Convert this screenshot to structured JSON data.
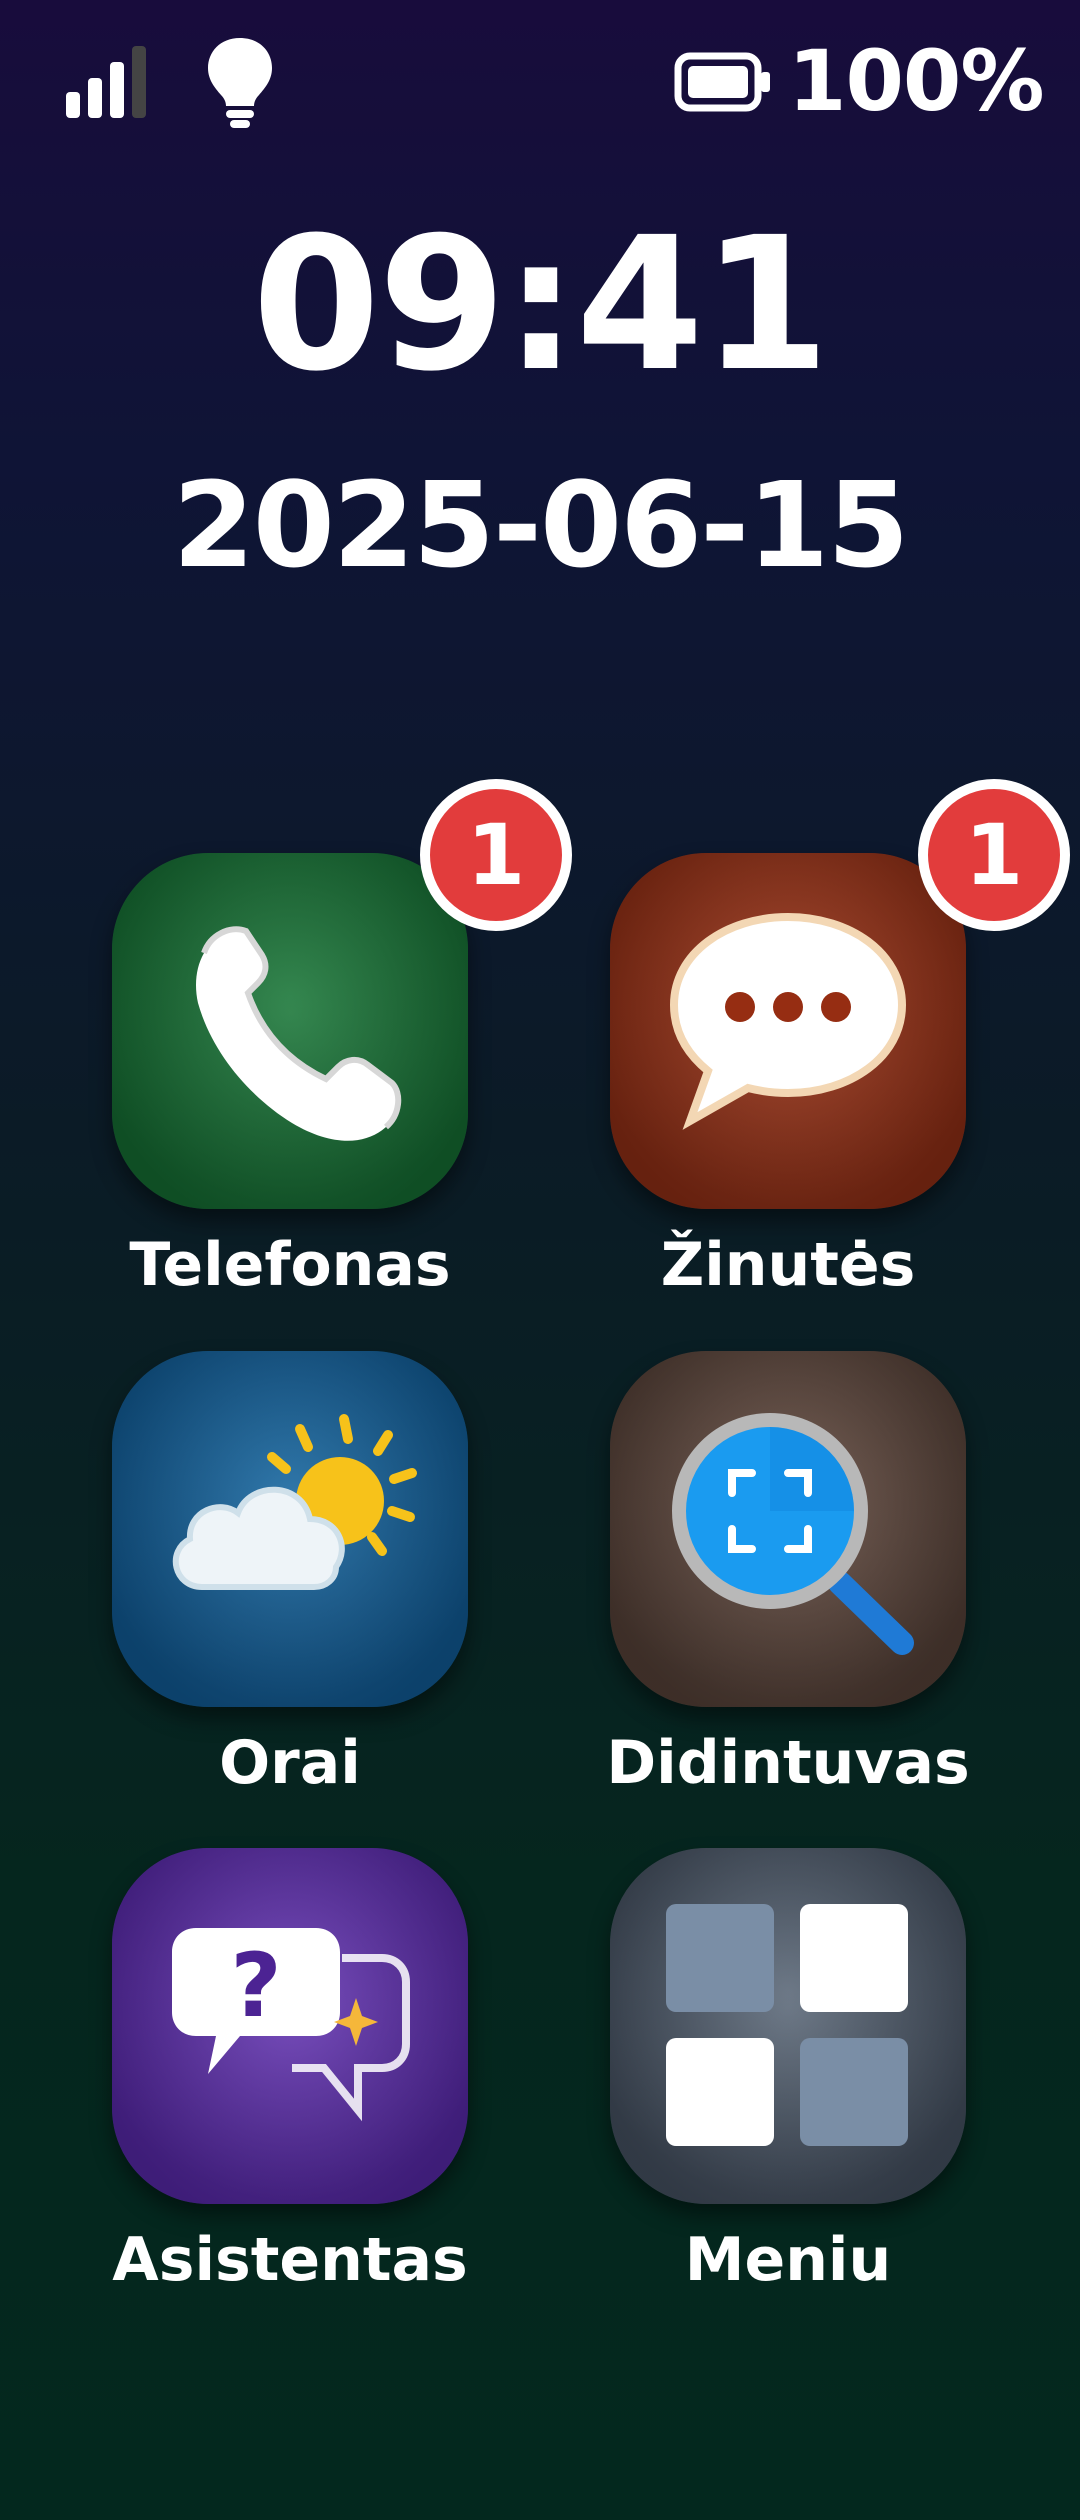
{
  "status_bar": {
    "battery_percent_label": "100%",
    "battery_level": 1.0,
    "signal_bars": 3,
    "signal_max": 4,
    "icons": [
      "signal-icon",
      "lightbulb-icon",
      "battery-icon"
    ]
  },
  "clock": {
    "time": "09:41",
    "date": "2025-06-15"
  },
  "apps": [
    {
      "label": "Telefonas",
      "icon": "phone-icon",
      "badge": "1",
      "color": "#1a6e35"
    },
    {
      "label": "Žinutės",
      "icon": "chat-bubble-icon",
      "badge": "1",
      "color": "#8e2f16"
    },
    {
      "label": "Orai",
      "icon": "weather-icon",
      "badge": null,
      "color": "#0f5a90"
    },
    {
      "label": "Didintuvas",
      "icon": "magnifier-icon",
      "badge": null,
      "color": "#5a443a"
    },
    {
      "label": "Asistentas",
      "icon": "assistant-icon",
      "badge": null,
      "color": "#5a2ca6"
    },
    {
      "label": "Meniu",
      "icon": "menu-grid-icon",
      "badge": null,
      "color": "#4a5564"
    }
  ],
  "colors": {
    "badge": "#e23c3c",
    "text": "#ffffff"
  }
}
